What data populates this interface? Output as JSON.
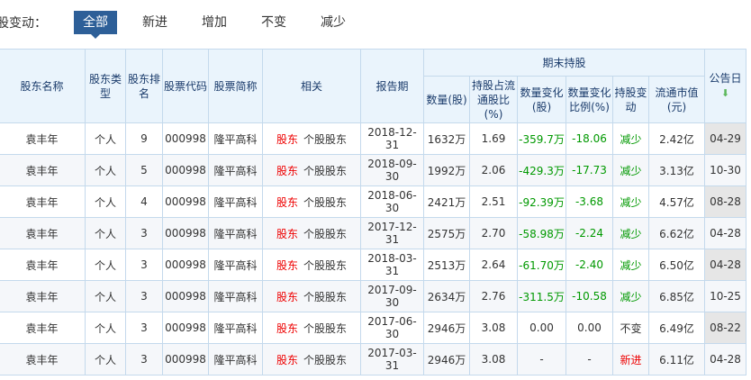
{
  "filter": {
    "label": "股变动：",
    "tabs": [
      "全部",
      "新进",
      "增加",
      "不变",
      "减少"
    ],
    "active": 0
  },
  "headers": {
    "name": "股东名称",
    "type": "股东类型",
    "rank": "股东排名",
    "code": "股票代码",
    "short": "股票简称",
    "related": "相关",
    "period": "报告期",
    "group": "期末持股",
    "qty": "数量(股)",
    "ratio": "持股占流通股比(%)",
    "chg": "数量变化(股)",
    "chgpct": "数量变化比例(%)",
    "change": "持股变动",
    "mv": "流通市值(元)",
    "date": "公告日"
  },
  "colors": {
    "accent": "#2d5f98",
    "up": "#e00000",
    "down": "#009900"
  },
  "rows": [
    {
      "name": "袁丰年",
      "type": "个人",
      "rank": "9",
      "code": "000998",
      "short": "隆平高科",
      "rel1": "股东",
      "rel2": "个股股东",
      "period": "2018-12-31",
      "qty": "1632万",
      "ratio": "1.69",
      "chg": "-359.7万",
      "chgpct": "-18.06",
      "change": "减少",
      "mv": "2.42亿",
      "date": "04-29"
    },
    {
      "name": "袁丰年",
      "type": "个人",
      "rank": "5",
      "code": "000998",
      "short": "隆平高科",
      "rel1": "股东",
      "rel2": "个股股东",
      "period": "2018-09-30",
      "qty": "1992万",
      "ratio": "2.06",
      "chg": "-429.3万",
      "chgpct": "-17.73",
      "change": "减少",
      "mv": "3.13亿",
      "date": "10-30"
    },
    {
      "name": "袁丰年",
      "type": "个人",
      "rank": "4",
      "code": "000998",
      "short": "隆平高科",
      "rel1": "股东",
      "rel2": "个股股东",
      "period": "2018-06-30",
      "qty": "2421万",
      "ratio": "2.51",
      "chg": "-92.39万",
      "chgpct": "-3.68",
      "change": "减少",
      "mv": "4.57亿",
      "date": "08-28"
    },
    {
      "name": "袁丰年",
      "type": "个人",
      "rank": "3",
      "code": "000998",
      "short": "隆平高科",
      "rel1": "股东",
      "rel2": "个股股东",
      "period": "2017-12-31",
      "qty": "2575万",
      "ratio": "2.70",
      "chg": "-58.98万",
      "chgpct": "-2.24",
      "change": "减少",
      "mv": "6.62亿",
      "date": "04-28"
    },
    {
      "name": "袁丰年",
      "type": "个人",
      "rank": "3",
      "code": "000998",
      "short": "隆平高科",
      "rel1": "股东",
      "rel2": "个股股东",
      "period": "2018-03-31",
      "qty": "2513万",
      "ratio": "2.64",
      "chg": "-61.70万",
      "chgpct": "-2.40",
      "change": "减少",
      "mv": "6.50亿",
      "date": "04-28"
    },
    {
      "name": "袁丰年",
      "type": "个人",
      "rank": "3",
      "code": "000998",
      "short": "隆平高科",
      "rel1": "股东",
      "rel2": "个股股东",
      "period": "2017-09-30",
      "qty": "2634万",
      "ratio": "2.76",
      "chg": "-311.5万",
      "chgpct": "-10.58",
      "change": "减少",
      "mv": "6.85亿",
      "date": "10-25"
    },
    {
      "name": "袁丰年",
      "type": "个人",
      "rank": "3",
      "code": "000998",
      "short": "隆平高科",
      "rel1": "股东",
      "rel2": "个股股东",
      "period": "2017-06-30",
      "qty": "2946万",
      "ratio": "3.08",
      "chg": "0.00",
      "chgpct": "0.00",
      "change": "不变",
      "mv": "6.49亿",
      "date": "08-22"
    },
    {
      "name": "袁丰年",
      "type": "个人",
      "rank": "3",
      "code": "000998",
      "short": "隆平高科",
      "rel1": "股东",
      "rel2": "个股股东",
      "period": "2017-03-31",
      "qty": "2946万",
      "ratio": "3.08",
      "chg": "-",
      "chgpct": "-",
      "change": "新进",
      "mv": "6.11亿",
      "date": "04-28"
    }
  ]
}
